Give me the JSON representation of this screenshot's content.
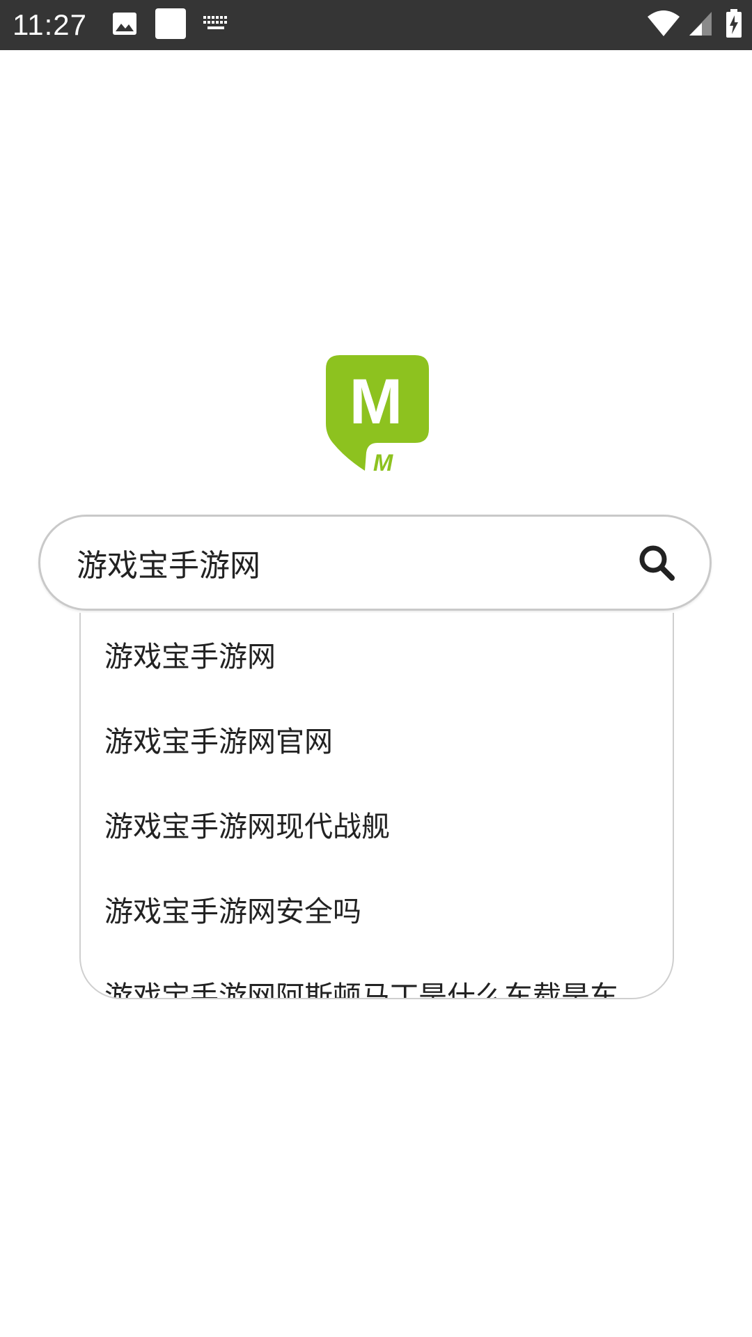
{
  "status_bar": {
    "time": "11:27",
    "left_icons": [
      "image-icon",
      "square-notification-icon",
      "keyboard-icon"
    ],
    "right_icons": [
      "wifi-icon",
      "signal-icon",
      "battery-charging-icon"
    ]
  },
  "logo": {
    "letter_big": "M",
    "letter_small": "M",
    "color": "#8dc21f"
  },
  "search": {
    "value": "游戏宝手游网",
    "icon": "search-icon"
  },
  "suggestions": [
    "游戏宝手游网",
    "游戏宝手游网官网",
    "游戏宝手游网现代战舰",
    "游戏宝手游网安全吗",
    "游戏宝手游网阿斯顿马丁是什么车载是车"
  ]
}
